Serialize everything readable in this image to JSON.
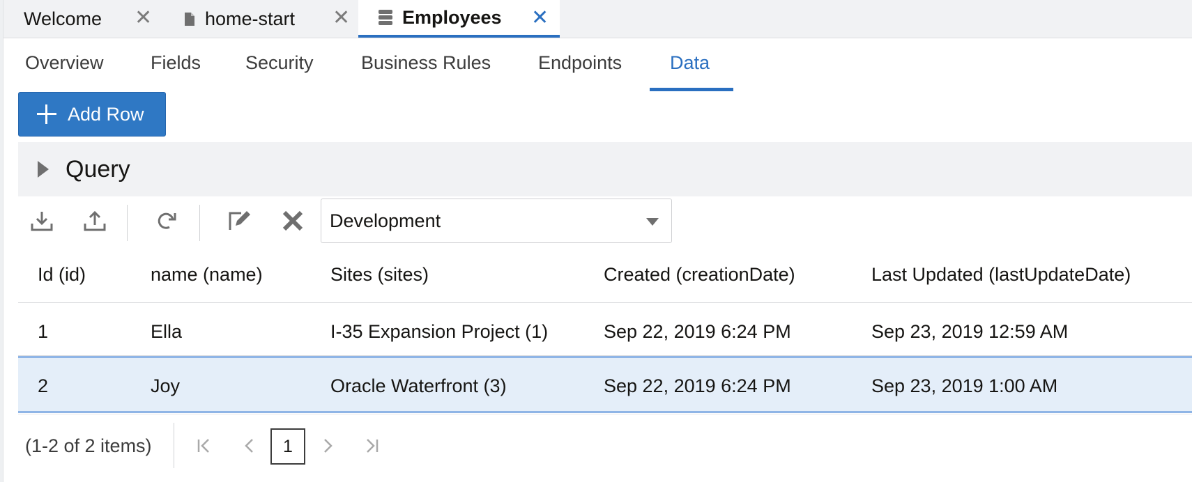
{
  "editor_tabs": [
    {
      "label": "Welcome",
      "icon": null,
      "active": false
    },
    {
      "label": "home-start",
      "icon": "file-icon",
      "active": false
    },
    {
      "label": "Employees",
      "icon": "database-icon",
      "active": true
    }
  ],
  "close_glyph": "✕",
  "sub_tabs": [
    {
      "label": "Overview"
    },
    {
      "label": "Fields"
    },
    {
      "label": "Security"
    },
    {
      "label": "Business Rules"
    },
    {
      "label": "Endpoints"
    },
    {
      "label": "Data",
      "active": true
    }
  ],
  "add_row": {
    "label": "Add Row"
  },
  "query": {
    "label": "Query",
    "expanded": false
  },
  "toolbar": {
    "icons": [
      "download-icon",
      "upload-icon",
      "refresh-icon",
      "edit-icon",
      "delete-icon"
    ],
    "environment": "Development"
  },
  "table": {
    "columns": [
      "Id (id)",
      "name (name)",
      "Sites (sites)",
      "Created (creationDate)",
      "Last Updated (lastUpdateDate)"
    ],
    "rows": [
      {
        "id": "1",
        "name": "Ella",
        "sites": "I-35 Expansion Project (1)",
        "created": "Sep 22, 2019 6:24 PM",
        "updated": "Sep 23, 2019 12:59 AM",
        "selected": false
      },
      {
        "id": "2",
        "name": "Joy",
        "sites": "Oracle Waterfront (3)",
        "created": "Sep 22, 2019 6:24 PM",
        "updated": "Sep 23, 2019 1:00 AM",
        "selected": true
      }
    ]
  },
  "pager": {
    "summary": "(1-2 of 2 items)",
    "current_page": "1"
  },
  "colors": {
    "accent": "#2a6fc0",
    "button": "#2f78c4",
    "selected_row": "#e4eef9",
    "panel": "#f1f2f4"
  }
}
